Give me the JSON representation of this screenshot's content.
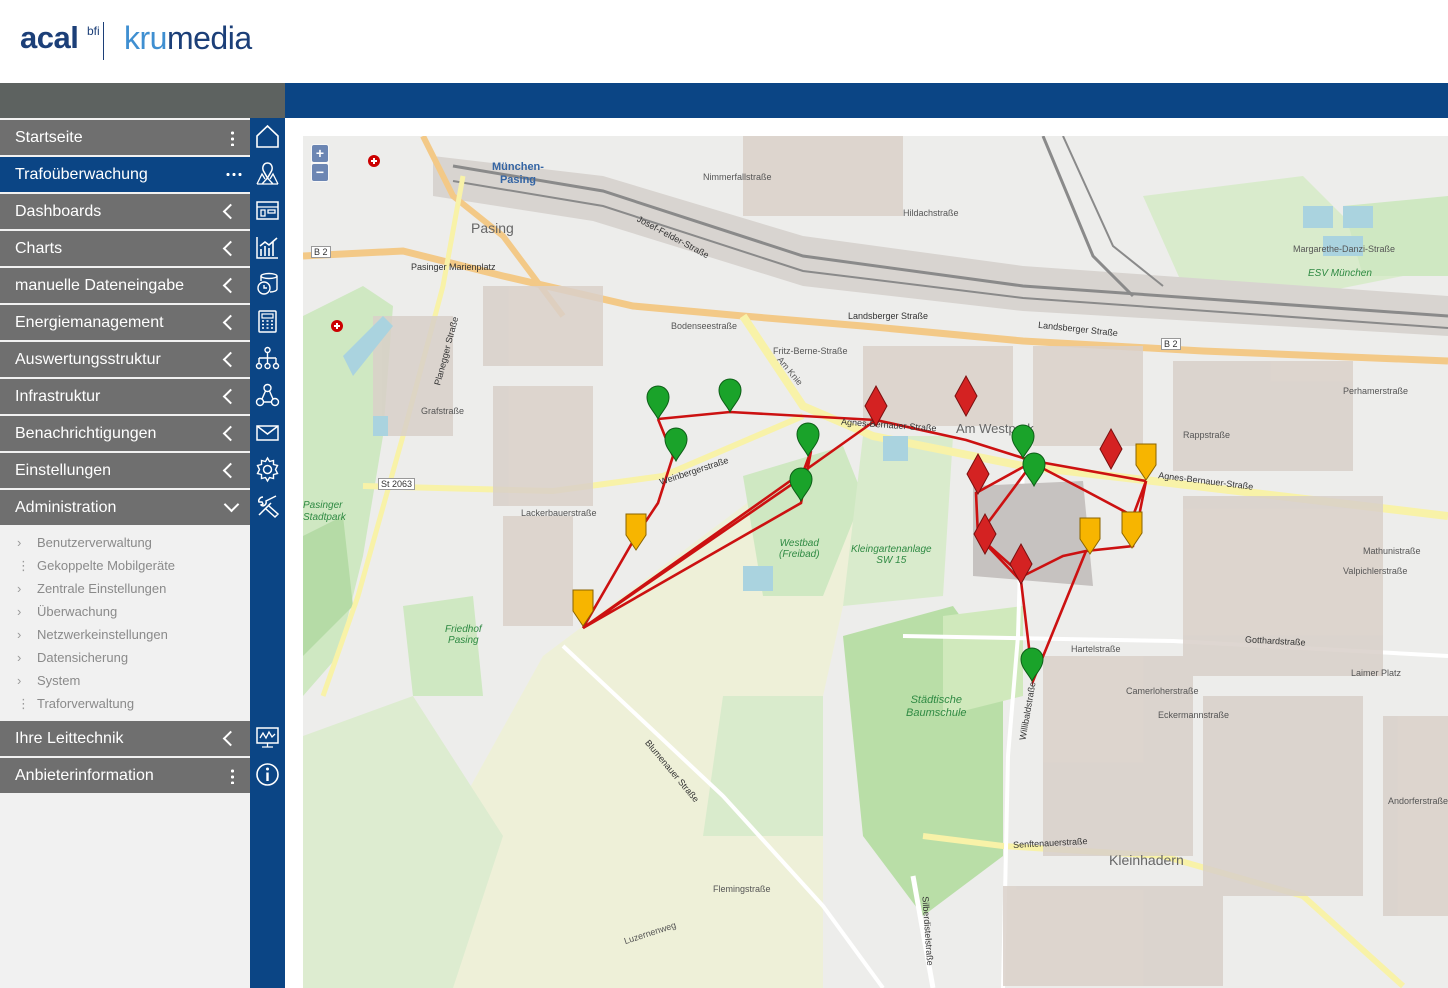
{
  "brand": {
    "logo_left": "acal",
    "logo_left_sup": "bfi",
    "logo_right_a": "kru",
    "logo_right_b": "media"
  },
  "menu": [
    {
      "label": "Startseite",
      "control": "dots-vertical"
    },
    {
      "label": "Trafoüberwachung",
      "control": "dots-horizontal",
      "active": true
    },
    {
      "label": "Dashboards",
      "control": "chevron-left"
    },
    {
      "label": "Charts",
      "control": "chevron-left"
    },
    {
      "label": "manuelle Dateneingabe",
      "control": "chevron-left"
    },
    {
      "label": "Energiemanagement",
      "control": "chevron-left"
    },
    {
      "label": "Auswertungsstruktur",
      "control": "chevron-left"
    },
    {
      "label": "Infrastruktur",
      "control": "chevron-left"
    },
    {
      "label": "Benachrichtigungen",
      "control": "chevron-left"
    },
    {
      "label": "Einstellungen",
      "control": "chevron-left"
    },
    {
      "label": "Administration",
      "control": "chevron-down"
    },
    {
      "label": "Ihre Leittechnik",
      "control": "chevron-left"
    },
    {
      "label": "Anbieterinformation",
      "control": "dots-vertical"
    }
  ],
  "admin_submenu": [
    {
      "label": "Benutzerverwaltung",
      "marker": "›"
    },
    {
      "label": "Gekoppelte Mobilgeräte",
      "marker": "⋮"
    },
    {
      "label": "Zentrale Einstellungen",
      "marker": "›"
    },
    {
      "label": "Überwachung",
      "marker": "›"
    },
    {
      "label": "Netzwerkeinstellungen",
      "marker": "›"
    },
    {
      "label": "Datensicherung",
      "marker": "›"
    },
    {
      "label": "System",
      "marker": "›"
    },
    {
      "label": "Traforverwaltung",
      "marker": "⋮"
    }
  ],
  "icons": [
    "home-icon",
    "map-icon",
    "dashboard-icon",
    "chart-icon",
    "data-entry-icon",
    "calculator-icon",
    "hierarchy-icon",
    "infrastructure-icon",
    "mail-icon",
    "gear-icon",
    "tools-icon",
    "monitor-icon",
    "info-icon"
  ],
  "map": {
    "zoom_in": "+",
    "zoom_out": "−",
    "labels": {
      "pasing_station": "München-\nPasing",
      "pasing": "Pasing",
      "westbad": "Westbad\n(Freibad)",
      "kleingarten": "Kleingartenanlage\nSW 15",
      "friedhof": "Friedhof\nPasing",
      "baumschule": "Städtische\nBaumschule",
      "kleinhadern": "Kleinhadern",
      "am_westpark": "Am Westpark",
      "esv": "ESV München",
      "stadtpark": "Pasinger\nStadtpark",
      "landsberger1": "Landsberger Straße",
      "landsberger2": "Landsberger Straße",
      "agnes1": "Agnes-Bernauer-Straße",
      "agnes2": "Agnes-Bernauer-Straße",
      "weinberger": "Weinbergerstraße",
      "st2063": "St 2063",
      "josef_felder": "Josef-Felder-Straße",
      "b2a": "B 2",
      "b2b": "B 2",
      "senftenauer": "Senftenauerstraße",
      "gotthard": "Gotthardstraße",
      "blumenauer": "Blumenauer Straße",
      "willibald": "Willibaldstraße",
      "silberdistel": "Silberdistelstraße",
      "pasinger_marienplatz": "Pasinger Marienplatz",
      "planegger": "Planegger Straße",
      "fritz_berne": "Fritz-Berne-Straße",
      "am_knie": "Am Knie",
      "hildachstrasse": "Hildachstraße",
      "nimmerfall": "Nimmerfallstraße",
      "laimer_platz": "Laimer Platz",
      "rappstrasse": "Rappstraße",
      "mathunistrasse": "Mathunistraße",
      "eckermannstrasse": "Eckermannstraße",
      "fleming": "Flemingstraße",
      "luzernenweg": "Luzernenweg",
      "camerloher": "Camerloherstraße",
      "hartelstrasse": "Hartelstraße",
      "grafstrasse": "Grafstraße",
      "lackerbauer": "Lackerbauerstraße",
      "bodensee": "Bodenseestraße",
      "valpichler": "Valpichlerstraße",
      "margarethe": "Margarethe-Danzi-Straße",
      "perhamer": "Perhamerstraße",
      "andorfer": "Andorferstraße"
    }
  },
  "markers": {
    "green": "#1aa32a",
    "red": "#d42222",
    "yellow": "#f7b500",
    "line": "#cc1111"
  }
}
